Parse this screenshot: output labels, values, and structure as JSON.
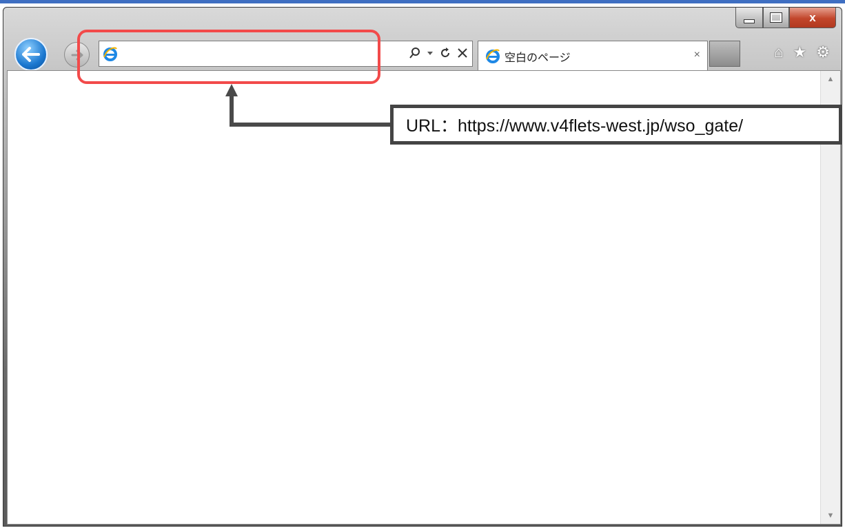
{
  "browser": {
    "tab_title": "空白のページ",
    "tab_close": "×",
    "address_value": "",
    "close_label": "x"
  },
  "icons": {
    "back": "back-arrow-icon",
    "forward": "forward-arrow-icon",
    "ie_logo": "internet-explorer-logo",
    "search": "search-icon",
    "dropdown": "dropdown-caret-icon",
    "refresh": "refresh-icon",
    "stop": "stop-icon",
    "home": "home-icon",
    "favorites": "star-icon",
    "tools": "gear-icon"
  },
  "annotation": {
    "callout_text": "URL：https://www.v4flets-west.jp/wso_gate/",
    "highlight_color": "#f24a4a"
  },
  "colors": {
    "accent_bar": "#3f6fc2"
  }
}
